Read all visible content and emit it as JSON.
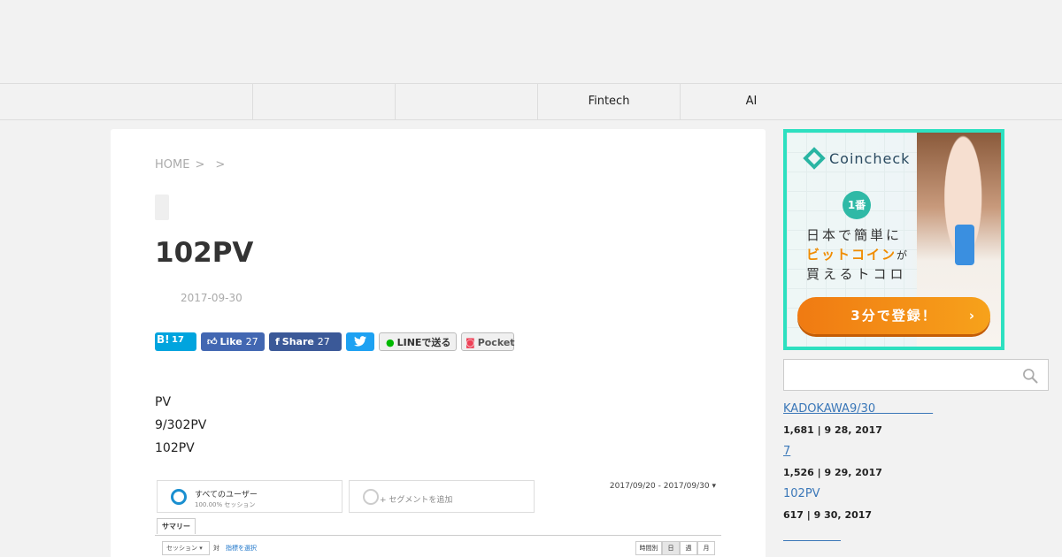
{
  "nav": {
    "items": [
      "",
      "",
      "Fintech",
      "AI"
    ]
  },
  "breadcrumb": {
    "home": "HOME",
    "sep1": ">",
    "sep2": ">"
  },
  "post": {
    "title": "102PV",
    "date": "2017-09-30",
    "body_lines": [
      "PV",
      "9/302PV",
      "102PV"
    ]
  },
  "share": {
    "hatena_label": "B!",
    "hatena_count": "17",
    "like_label": "Like",
    "like_count": "27",
    "share_label": "Share",
    "share_count": "27",
    "line_label": "LINEで送る",
    "pocket_label": "Pocket"
  },
  "analytics_screenshot": {
    "segment1_name": "すべてのユーザー",
    "segment1_sub": "100.00% セッション",
    "segment2_name": "+ セグメントを追加",
    "date_range": "2017/09/20 - 2017/09/30",
    "tab": "サマリー",
    "select": "セッション",
    "vs": "対",
    "pick_metric": "指標を選択",
    "period_buttons": [
      "時間別",
      "日",
      "週",
      "月"
    ]
  },
  "ad": {
    "brand": "Coincheck",
    "badge": "1番",
    "line1": "日本で簡単に",
    "line2": "ビットコイン",
    "line2_suffix": "が",
    "line3": "買えるトコロ",
    "cta": "3分で登録！",
    "cta_chevron": "›",
    "accent": "#2de0c0"
  },
  "search": {
    "placeholder": "",
    "icon": "search-icon"
  },
  "sidebar": {
    "posts": [
      {
        "title": "KADOKAWA9/30　　　　　",
        "meta": "1,681 | 9 28, 2017"
      },
      {
        "title": "7",
        "meta": "1,526 | 9 29, 2017"
      },
      {
        "title": "102PV",
        "meta": "617 | 9 30, 2017"
      },
      {
        "title": "　　　　　",
        "meta": ""
      }
    ]
  }
}
